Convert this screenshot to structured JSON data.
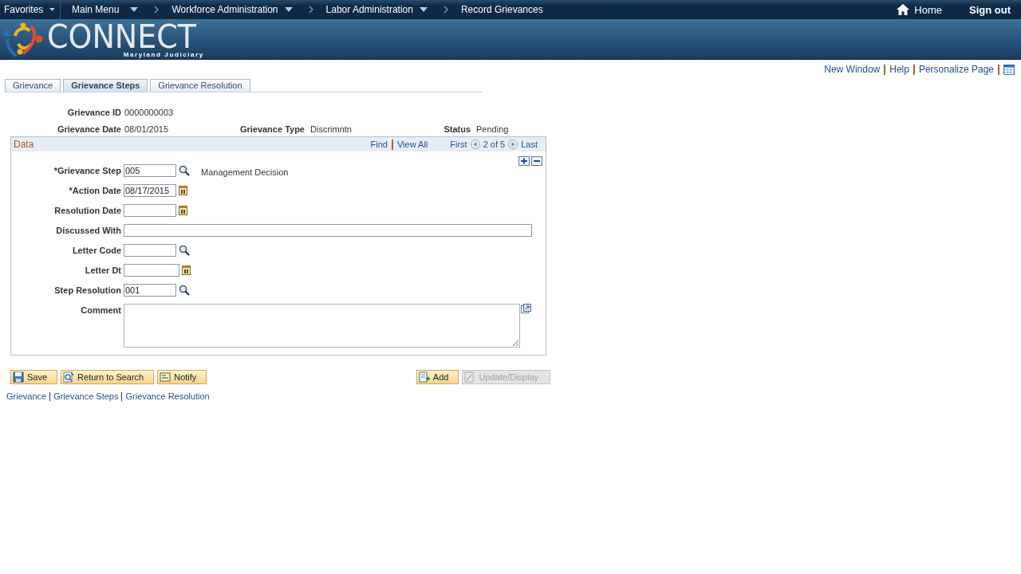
{
  "nav": {
    "items": [
      {
        "label": "Favorites",
        "kind": "menu"
      },
      {
        "label": "Main Menu",
        "kind": "menu"
      },
      {
        "label": "Workforce Administration",
        "kind": "menu"
      },
      {
        "label": "Labor Administration",
        "kind": "menu"
      },
      {
        "label": "Record Grievances",
        "kind": "crumb"
      }
    ],
    "home": "Home",
    "sign_out": "Sign out"
  },
  "logo": {
    "name": "CONNECT",
    "subtitle": "Maryland Judiciary"
  },
  "page_links": [
    "New Window",
    "Help",
    "Personalize Page"
  ],
  "tabs": [
    {
      "label": "Grievance",
      "selected": false
    },
    {
      "label": "Grievance Steps",
      "selected": true
    },
    {
      "label": "Grievance Resolution",
      "selected": false
    }
  ],
  "header_rows": [
    [
      {
        "label": "Grievance ID",
        "value": "0000000003"
      }
    ],
    [
      {
        "label": "Grievance Date",
        "value": "08/01/2015"
      },
      {
        "label": "Grievance Type",
        "value": "Discrimntn"
      },
      {
        "label": "Status",
        "value": "Pending"
      }
    ]
  ],
  "panel": {
    "title": "Data",
    "find": "Find",
    "view_all": "View All",
    "first": "First",
    "counter": "2 of 5",
    "last": "Last",
    "fields": [
      {
        "label": "*Grievance Step",
        "kind": "lookup",
        "value": "005",
        "description": "Management Decision"
      },
      {
        "label": "*Action Date",
        "kind": "date",
        "value": "08/17/2015"
      },
      {
        "label": "Resolution Date",
        "kind": "date"
      },
      {
        "label": "Discussed With",
        "kind": "wide"
      },
      {
        "label": "Letter Code",
        "kind": "lookup"
      },
      {
        "label": "Letter Dt",
        "kind": "date"
      },
      {
        "label": "Step Resolution",
        "kind": "lookup",
        "value": "001"
      },
      {
        "label": "Comment",
        "kind": "textarea"
      }
    ]
  },
  "buttons_left": [
    {
      "label": "Save",
      "kind": "save",
      "disabled": false
    },
    {
      "label": "Return to Search",
      "kind": "search",
      "disabled": false
    },
    {
      "label": "Notify",
      "kind": "notify",
      "disabled": false
    }
  ],
  "buttons_right": [
    {
      "label": "Add",
      "kind": "add",
      "disabled": false
    },
    {
      "label": "Update/Display",
      "kind": "update",
      "disabled": true
    }
  ],
  "footer_links": [
    "Grievance",
    "Grievance Steps",
    "Grievance Resolution"
  ]
}
